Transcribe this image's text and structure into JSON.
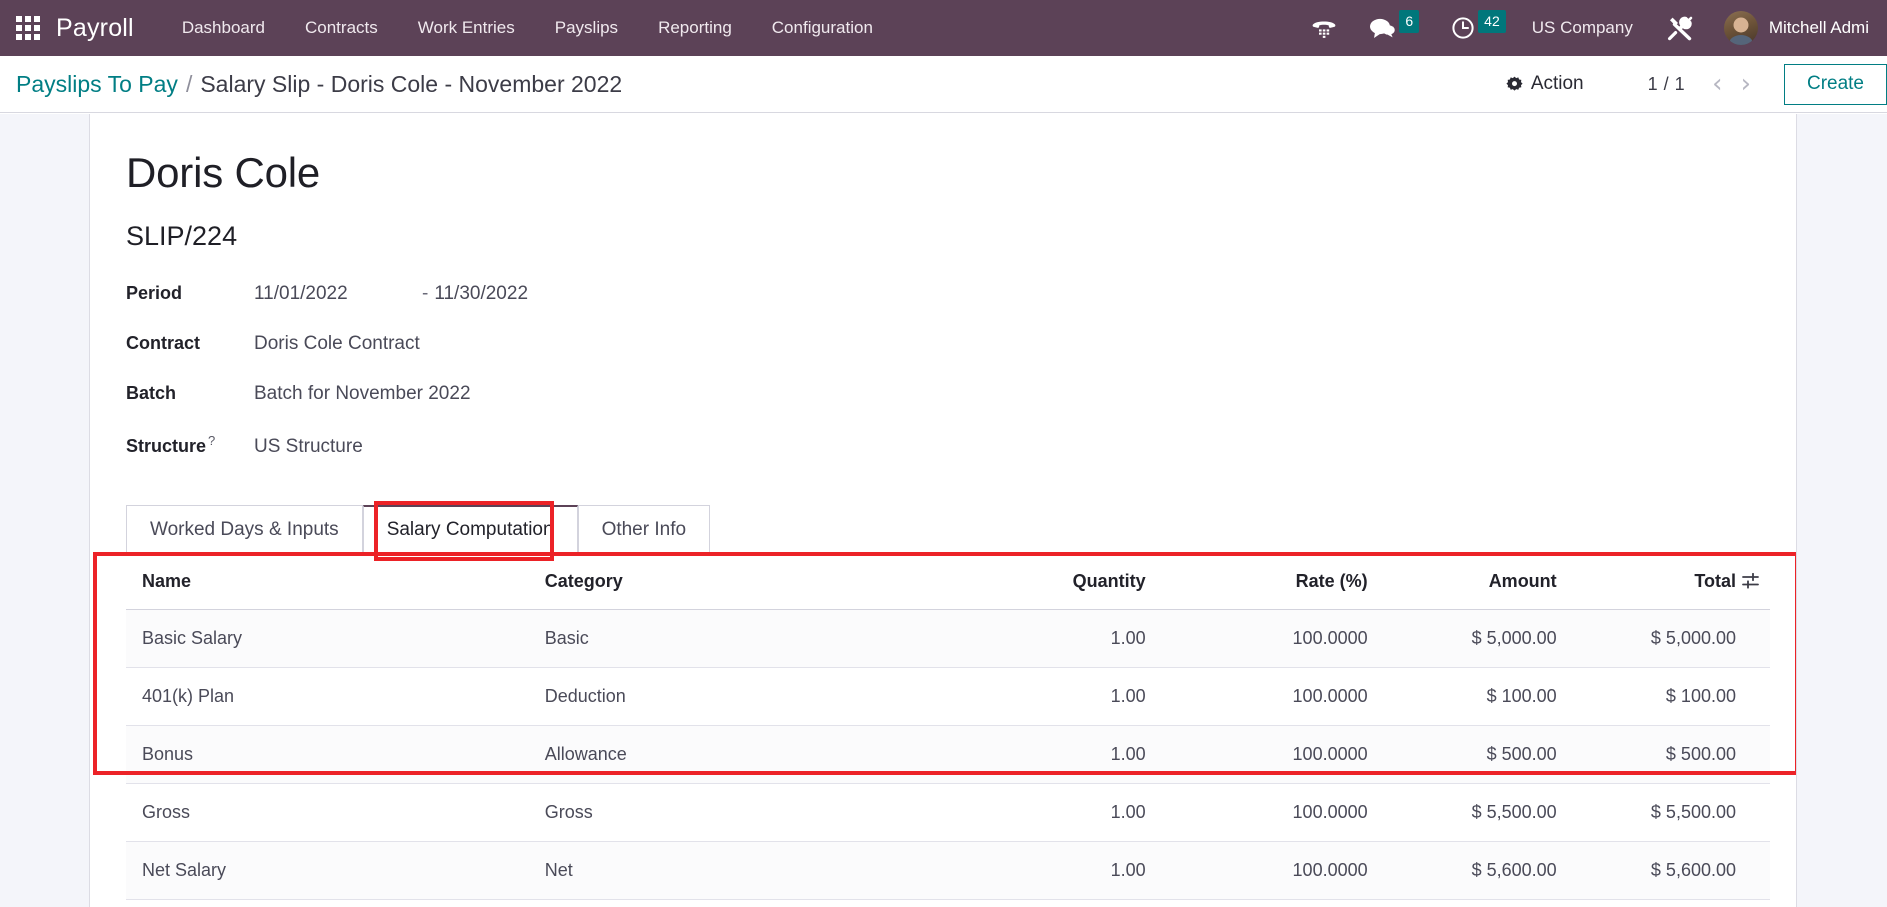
{
  "topbar": {
    "apps_icon": "apps-grid-icon",
    "brand": "Payroll",
    "menu": [
      {
        "label": "Dashboard"
      },
      {
        "label": "Contracts"
      },
      {
        "label": "Work Entries"
      },
      {
        "label": "Payslips"
      },
      {
        "label": "Reporting"
      },
      {
        "label": "Configuration"
      }
    ],
    "voip_icon": "telephone-icon",
    "messages": {
      "icon": "chat-bubble-icon",
      "count": "6"
    },
    "activities": {
      "icon": "clock-icon",
      "count": "42"
    },
    "company": "US Company",
    "debug_icon": "tools-icon",
    "user": {
      "avatar": "user-avatar",
      "name": "Mitchell Admi"
    },
    "accent": "#5c4257",
    "badge_color": "#00777b"
  },
  "controlpanel": {
    "breadcrumb_root": "Payslips To Pay",
    "breadcrumb_separator": "/",
    "breadcrumb_current": "Salary Slip - Doris Cole - November 2022",
    "action_label": "Action",
    "action_icon": "gear-icon",
    "pager": "1 / 1",
    "prev_icon": "chevron-left-icon",
    "next_icon": "chevron-right-icon",
    "create_label": "Create",
    "link_color": "#017e84"
  },
  "record": {
    "title": "Doris Cole",
    "reference": "SLIP/224",
    "fields": [
      {
        "label": "Period",
        "help": "",
        "value_from": "11/01/2022",
        "dash": "-",
        "value_to": "11/30/2022"
      },
      {
        "label": "Contract",
        "help": "",
        "value": "Doris Cole Contract"
      },
      {
        "label": "Batch",
        "help": "",
        "value": "Batch for November 2022"
      },
      {
        "label": "Structure",
        "help": "?",
        "value": "US Structure"
      }
    ]
  },
  "notebook": {
    "tabs": [
      {
        "label": "Worked Days & Inputs",
        "active": false
      },
      {
        "label": "Salary Computation",
        "active": true
      },
      {
        "label": "Other Info",
        "active": false
      }
    ],
    "highlight_color": "#ec2227"
  },
  "lines_table": {
    "optional_columns_icon": "column-settings-icon",
    "columns": [
      {
        "label": "Name",
        "key": "name"
      },
      {
        "label": "Category",
        "key": "category"
      },
      {
        "label": "Quantity",
        "key": "quantity"
      },
      {
        "label": "Rate (%)",
        "key": "rate"
      },
      {
        "label": "Amount",
        "key": "amount"
      },
      {
        "label": "Total",
        "key": "total"
      }
    ],
    "rows": [
      {
        "name": "Basic Salary",
        "category": "Basic",
        "quantity": "1.00",
        "rate": "100.0000",
        "amount": "$ 5,000.00",
        "total": "$ 5,000.00"
      },
      {
        "name": "401(k) Plan",
        "category": "Deduction",
        "quantity": "1.00",
        "rate": "100.0000",
        "amount": "$ 100.00",
        "total": "$ 100.00"
      },
      {
        "name": "Bonus",
        "category": "Allowance",
        "quantity": "1.00",
        "rate": "100.0000",
        "amount": "$ 500.00",
        "total": "$ 500.00"
      },
      {
        "name": "Gross",
        "category": "Gross",
        "quantity": "1.00",
        "rate": "100.0000",
        "amount": "$ 5,500.00",
        "total": "$ 5,500.00"
      },
      {
        "name": "Net Salary",
        "category": "Net",
        "quantity": "1.00",
        "rate": "100.0000",
        "amount": "$ 5,600.00",
        "total": "$ 5,600.00"
      }
    ]
  }
}
